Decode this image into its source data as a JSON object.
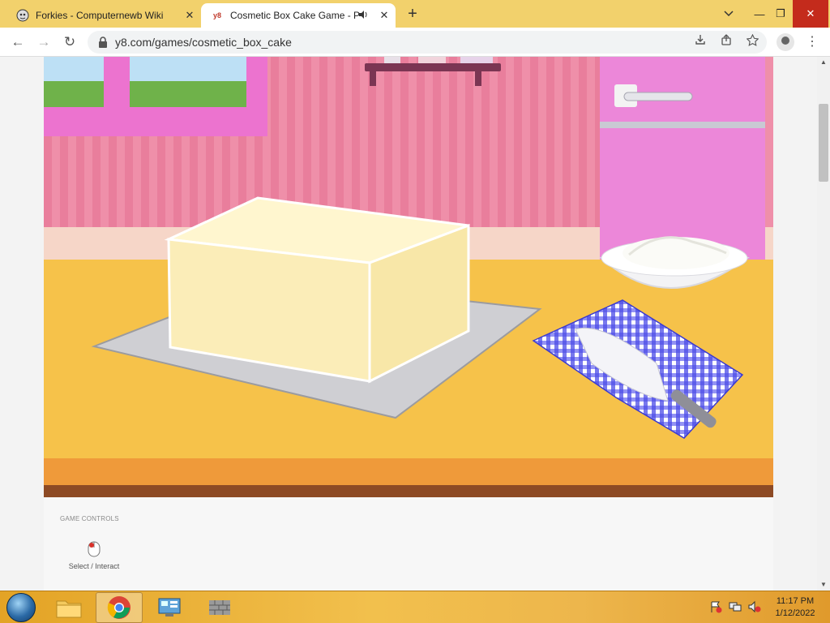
{
  "browser": {
    "tabs": [
      {
        "title": "Forkies - Computernewb Wiki",
        "close": "✕"
      },
      {
        "title": "Cosmetic Box Cake Game - P",
        "favicon_text": "y8",
        "close": "✕"
      }
    ],
    "new_tab": "+",
    "window_controls": {
      "minimize": "—",
      "maximize": "❐",
      "close": "✕"
    },
    "nav": {
      "back": "←",
      "forward": "→",
      "reload": "↻"
    },
    "url": "y8.com/games/cosmetic_box_cake",
    "menu": "⋮"
  },
  "colors": {
    "tabstrip": "#f2d16c",
    "wall": "#ef8fa9",
    "counter": "#f6c24a",
    "fridge": "#ec87d9",
    "taskbar": "#f2c04d"
  },
  "game_controls": {
    "title": "GAME CONTROLS",
    "items": [
      {
        "icon": "mouse-icon",
        "label": "Select / Interact"
      }
    ]
  },
  "taskbar": {
    "clock_time": "11:17 PM",
    "clock_date": "1/12/2022"
  }
}
